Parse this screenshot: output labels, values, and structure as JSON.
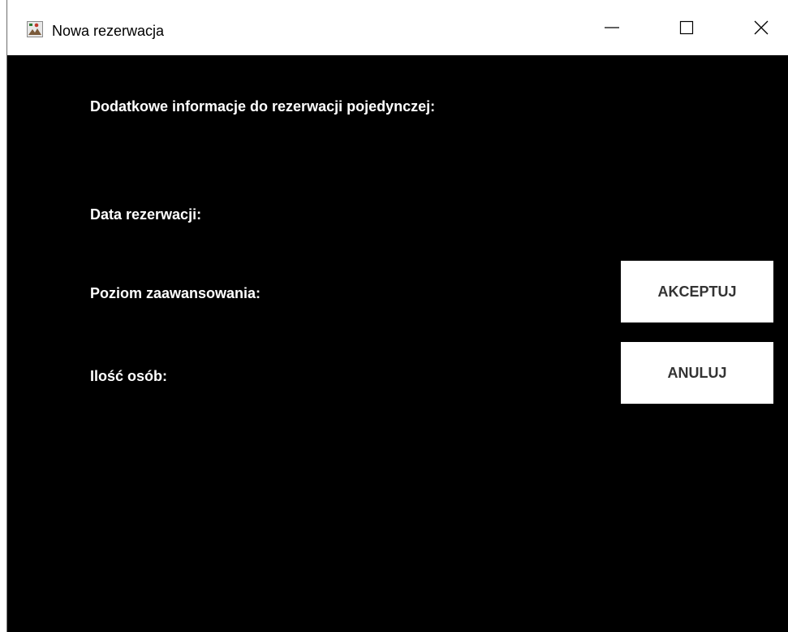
{
  "window": {
    "title": "Nowa rezerwacja",
    "app_icon": "java-app-icon",
    "controls": {
      "minimize_icon": "minimize-icon",
      "maximize_icon": "maximize-icon",
      "close_icon": "close-icon"
    }
  },
  "form": {
    "heading": "Dodatkowe informacje do rezerwacji pojedynczej:",
    "date_label": "Data rezerwacji:",
    "level_label": "Poziom zaawansowania:",
    "persons_label": "Ilość osób:"
  },
  "actions": {
    "accept_label": "AKCEPTUJ",
    "cancel_label": "ANULUJ"
  },
  "colors": {
    "background": "#000000",
    "label_text": "#ffffff",
    "button_bg": "#ffffff",
    "button_text": "#333333",
    "titlebar_bg": "#ffffff"
  }
}
